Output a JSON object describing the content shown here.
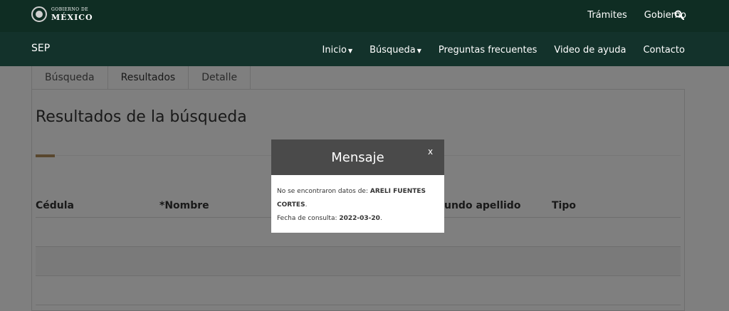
{
  "header": {
    "logo_line1": "GOBIERNO DE",
    "logo_line2": "MÉXICO",
    "nav": [
      "Trámites",
      "Gobierno"
    ]
  },
  "subheader": {
    "title": "SEP",
    "nav": {
      "inicio": "Inicio",
      "busqueda": "Búsqueda",
      "preguntas": "Preguntas frecuentes",
      "video": "Video de ayuda",
      "contacto": "Contacto"
    }
  },
  "tabs": [
    "Búsqueda",
    "Resultados",
    "Detalle"
  ],
  "results": {
    "heading": "Resultados de la búsqueda",
    "columns": [
      "Cédula",
      "*Nombre",
      "undo apellido",
      "Tipo"
    ]
  },
  "modal": {
    "title": "Mensaje",
    "close": "x",
    "no_data_prefix": "No se encontraron datos de: ",
    "name_part1": "ARELI FUENTES",
    "name_part2": "CORTES",
    "period": ".",
    "date_prefix": "Fecha de consulta: ",
    "date": "2022-03-20",
    "date_period": "."
  },
  "colors": {
    "topbar": "#0f2d23",
    "subbar": "#13322b",
    "accent": "#b38e5d",
    "modal_header": "#4a4a4a"
  }
}
